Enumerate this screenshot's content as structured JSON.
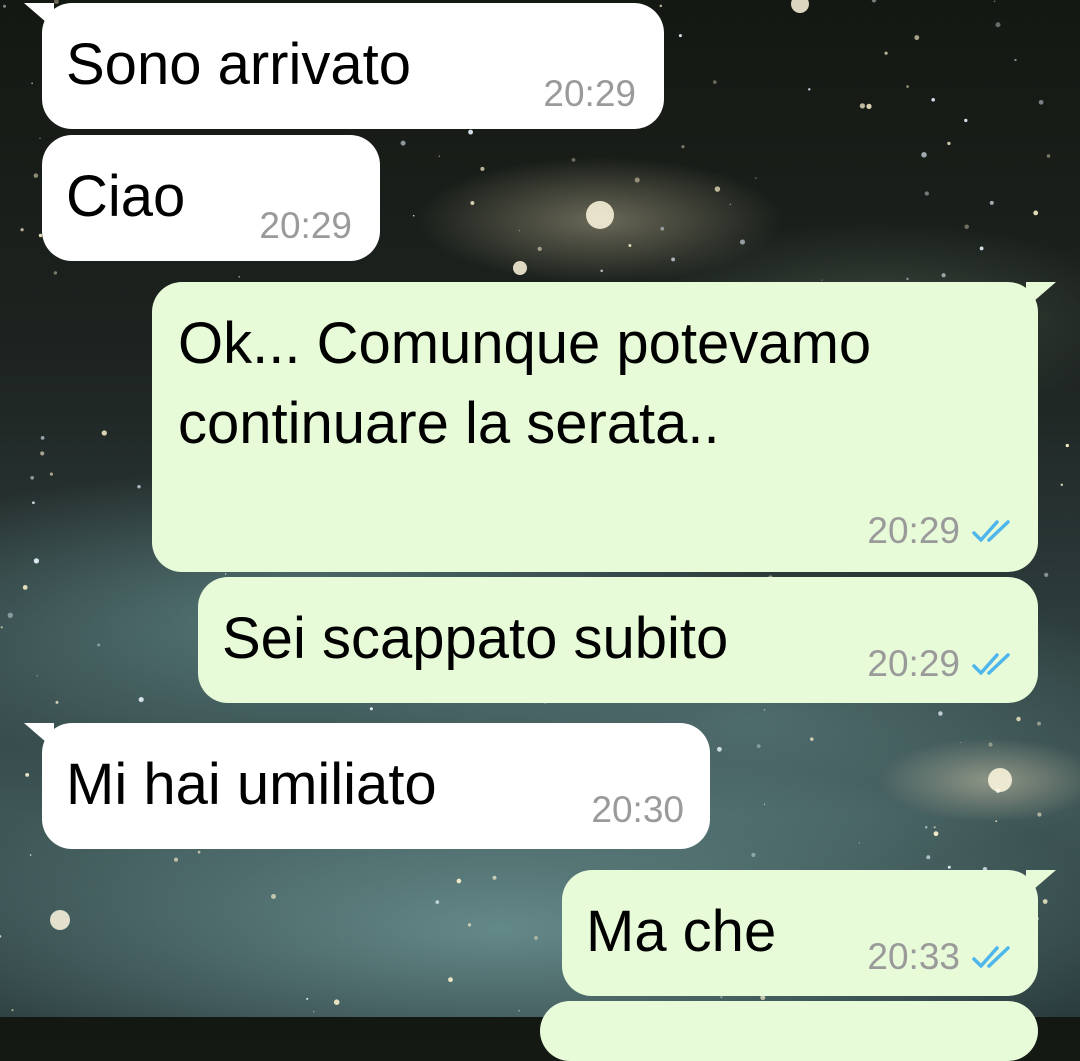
{
  "chat": {
    "messages": [
      {
        "direction": "incoming",
        "text": [
          "Sono arrivato"
        ],
        "time": "20:29"
      },
      {
        "direction": "incoming",
        "text": [
          "Ciao"
        ],
        "time": "20:29"
      },
      {
        "direction": "outgoing",
        "text": [
          "Ok... Comunque potevamo",
          "continuare la serata.."
        ],
        "time": "20:29",
        "status_icon": "double-check-icon"
      },
      {
        "direction": "outgoing",
        "text": [
          "Sei scappato subito"
        ],
        "time": "20:29",
        "status_icon": "double-check-icon"
      },
      {
        "direction": "incoming",
        "text": [
          "Mi hai umiliato"
        ],
        "time": "20:30"
      },
      {
        "direction": "outgoing",
        "text": [
          "Ma che"
        ],
        "time": "20:33",
        "status_icon": "double-check-icon"
      }
    ]
  },
  "colors": {
    "incoming_bubble": "#ffffff",
    "outgoing_bubble": "#e8fbd9",
    "timestamp": "#9a9a9a",
    "read_ticks": "#4fb6ec"
  }
}
